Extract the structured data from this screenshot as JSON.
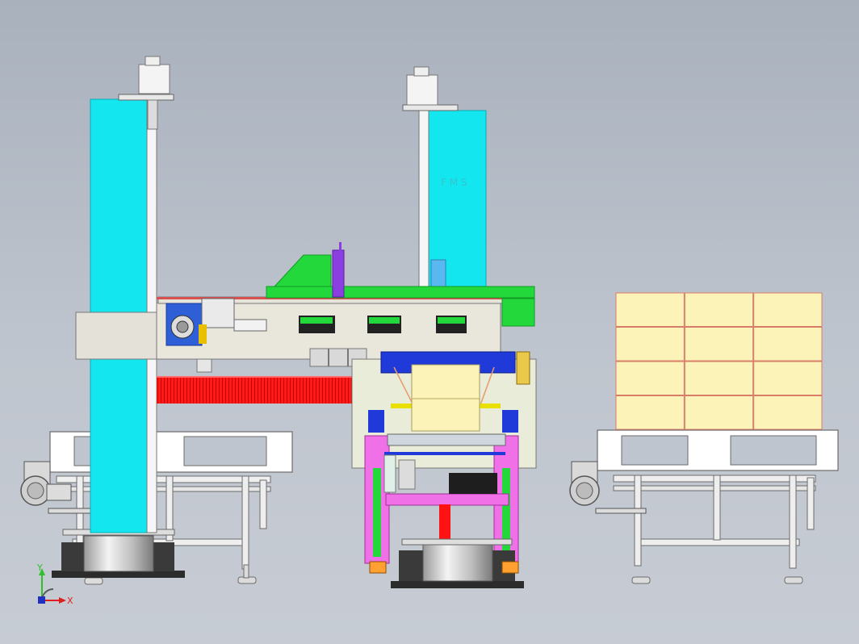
{
  "view": {
    "background_top": "#a9b1bd",
    "background_bottom": "#c7ccd4"
  },
  "axis_triad": {
    "y_label": "Y",
    "x_label": "X",
    "y_color": "#2fbf2f",
    "x_color": "#e02020",
    "z_color": "#2030c0"
  },
  "model": {
    "column_color": "#14e6f0",
    "arm_color": "#e9e6dc",
    "comb_color": "#ff1212",
    "carton_color": "#fbf3b8",
    "pallet_color": "#ffffff",
    "frame_color": "#f2f2ee",
    "gripper_frame_color": "#f070e8",
    "gripper_beam_color": "#1f3ad8",
    "green_accent": "#22d83a",
    "motor_color": "#2f5fd6",
    "base_color": "#2a2a2a",
    "turntable_color": "#d8d8d8",
    "carton_stack": {
      "rows": 4,
      "cols": 3
    }
  }
}
